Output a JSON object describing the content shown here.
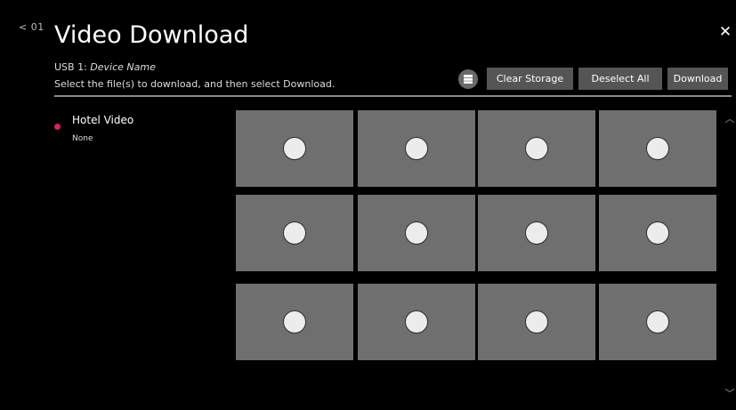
{
  "header": {
    "back_label": "< 01",
    "title": "Video Download",
    "close_icon": "close-icon"
  },
  "source": {
    "prefix": "USB 1: ",
    "device_name": "Device Name",
    "instruction": "Select the file(s) to download, and then select Download."
  },
  "toolbar": {
    "storage_icon": "storage-icon",
    "clear_storage": "Clear Storage",
    "deselect_all": "Deselect All",
    "download": "Download"
  },
  "categories": [
    {
      "label": "Hotel Video",
      "sub": "None",
      "dot_color": "#d6235a"
    }
  ],
  "grid": {
    "rows": 3,
    "cols": 4,
    "tile_color": "#6f6f6f",
    "selected": [
      false,
      false,
      false,
      false,
      false,
      false,
      false,
      false,
      false,
      false,
      false,
      false
    ]
  },
  "scroll": {
    "up_icon": "chevron-up-icon",
    "down_icon": "chevron-down-icon"
  },
  "colors": {
    "background": "#000000",
    "accent": "#d6235a",
    "button": "#555555"
  }
}
